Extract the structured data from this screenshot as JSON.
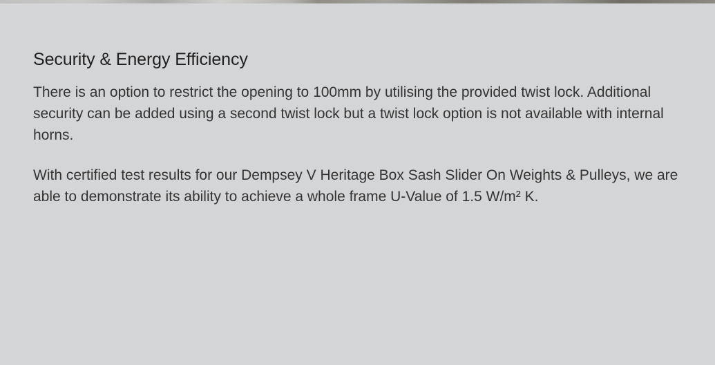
{
  "section": {
    "title": "Security & Energy Efficiency",
    "paragraphs": [
      "There is an option to restrict the opening to 100mm by utilising the provided twist lock. Additional security can be added using a second twist lock but a twist lock option is not available with internal horns.",
      "With certified test results for our Dempsey V Heritage Box Sash Slider On Weights & Pulleys, we are able to demonstrate its ability to achieve a whole frame U-Value of 1.5 W/m² K."
    ]
  },
  "colors": {
    "panel_background": "#d4d5d7",
    "heading_text": "#1f1f1f",
    "body_text": "#333333"
  }
}
